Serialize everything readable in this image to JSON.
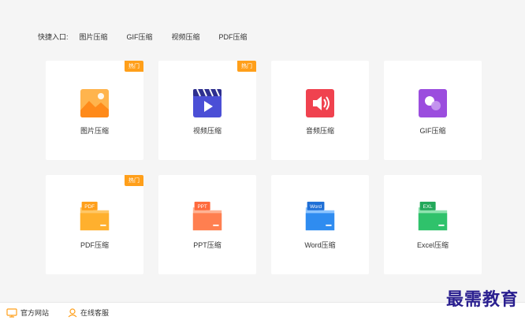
{
  "quick_bar": {
    "label": "快捷入口:",
    "links": [
      "图片压缩",
      "GIF压缩",
      "视频压缩",
      "PDF压缩"
    ]
  },
  "cards": [
    {
      "label": "图片压缩",
      "badge": "热门",
      "icon": "image-icon"
    },
    {
      "label": "视频压缩",
      "badge": "热门",
      "icon": "video-icon"
    },
    {
      "label": "音频压缩",
      "badge": "",
      "icon": "audio-icon"
    },
    {
      "label": "GIF压缩",
      "badge": "",
      "icon": "gif-icon"
    },
    {
      "label": "PDF压缩",
      "badge": "热门",
      "icon": "pdf-folder-icon",
      "tag": "PDF"
    },
    {
      "label": "PPT压缩",
      "badge": "",
      "icon": "ppt-folder-icon",
      "tag": "PPT"
    },
    {
      "label": "Word压缩",
      "badge": "",
      "icon": "word-folder-icon",
      "tag": "Word"
    },
    {
      "label": "Excel压缩",
      "badge": "",
      "icon": "excel-folder-icon",
      "tag": "EXL"
    }
  ],
  "footer": {
    "website": "官方网站",
    "support": "在线客服"
  },
  "watermark": "最需教育",
  "colors": {
    "badge": "#ff9f1a",
    "image": "#ff9a2e",
    "video": "#4b4fd6",
    "audio": "#f0424f",
    "gif": "#9b4dde",
    "pdf": "#ffb02e",
    "ppt": "#ff7f50",
    "word": "#2f8cf0",
    "excel": "#2fc26b"
  }
}
